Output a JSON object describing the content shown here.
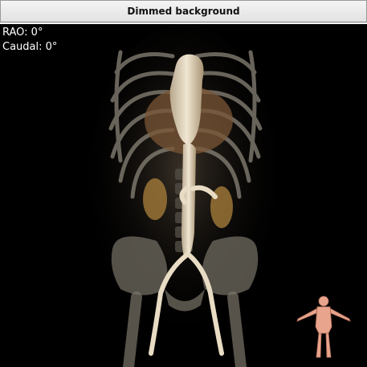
{
  "window": {
    "title": "Dimmed background"
  },
  "overlay": {
    "rao": "RAO: 0°",
    "caudal": "Caudal: 0°"
  },
  "viewport": {
    "content": "3D volume rendering (CT angiography)",
    "background": "#000000"
  },
  "icons": {
    "orientation": "orientation-figure-icon"
  }
}
